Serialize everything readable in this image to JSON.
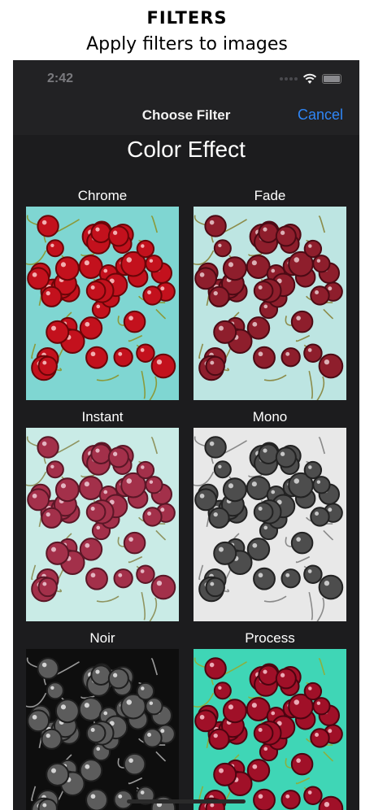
{
  "caption": {
    "title": "FILTERS",
    "subtitle": "Apply filters to images"
  },
  "status_bar": {
    "time": "2:42",
    "icons": [
      "signal-dots-icon",
      "wifi-icon",
      "battery-icon"
    ]
  },
  "nav_bar": {
    "title": "Choose Filter",
    "cancel_label": "Cancel",
    "accent_color": "#2f86f6"
  },
  "section": {
    "title": "Color Effect"
  },
  "filters": [
    {
      "label": "Chrome",
      "bg": "#7fd6d2",
      "cherry": "#c3111d",
      "cherry_dark": "#6a0508",
      "stem": "#8b9a3a",
      "highlight": "#ffd6d6"
    },
    {
      "label": "Fade",
      "bg": "#bde5e2",
      "cherry": "#8e1e2c",
      "cherry_dark": "#4c0a14",
      "stem": "#8c8c4a",
      "highlight": "#f0d4d8"
    },
    {
      "label": "Instant",
      "bg": "#c9ebe6",
      "cherry": "#a3304a",
      "cherry_dark": "#5a1626",
      "stem": "#8f9460",
      "highlight": "#f4d6de"
    },
    {
      "label": "Mono",
      "bg": "#e8e8e8",
      "cherry": "#4d4d4d",
      "cherry_dark": "#222222",
      "stem": "#8a8a8a",
      "highlight": "#e6e6e6"
    },
    {
      "label": "Noir",
      "bg": "#0e0e0e",
      "cherry": "#5c5c5c",
      "cherry_dark": "#1e1e1e",
      "stem": "#9a9a9a",
      "highlight": "#f2f2f2"
    },
    {
      "label": "Process",
      "bg": "#3fd6b6",
      "cherry": "#a01028",
      "cherry_dark": "#4c0410",
      "stem": "#8bb040",
      "highlight": "#ffd0d8"
    }
  ]
}
